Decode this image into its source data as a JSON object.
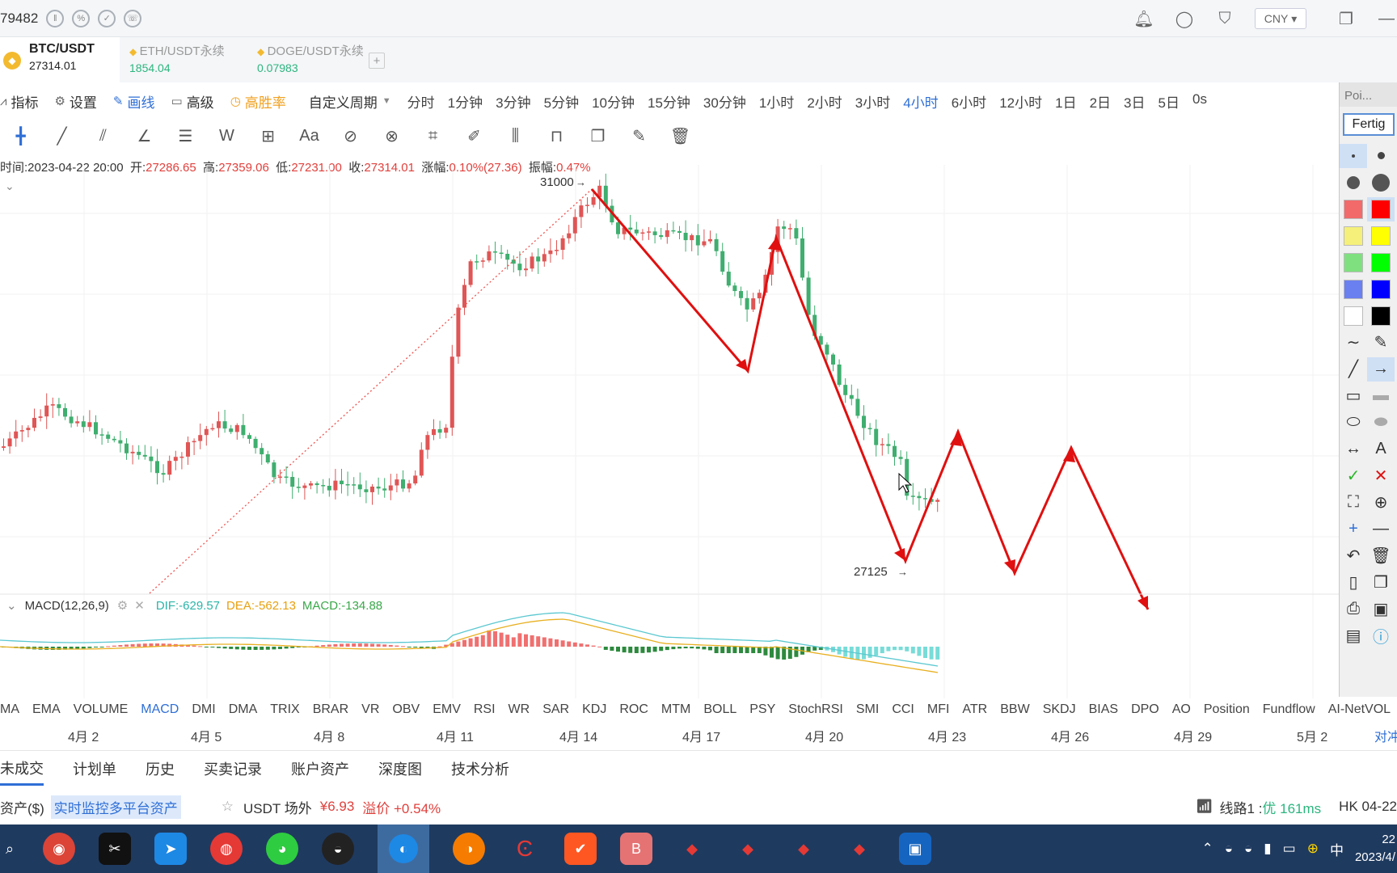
{
  "topbar": {
    "account_id": "79482",
    "currency": "CNY",
    "currency_arrow": "▾",
    "icons": [
      "bell-icon",
      "chat-icon",
      "shirt-icon",
      "window-icon",
      "minimize-icon"
    ]
  },
  "tabs": [
    {
      "pair": "BTC/USDT",
      "price": "27314.01",
      "active": true
    },
    {
      "pair": "ETH/USDT永续",
      "price": "1854.04",
      "active": false
    },
    {
      "pair": "DOGE/USDT永续",
      "price": "0.07983",
      "active": false
    }
  ],
  "add_tab": "+",
  "menu": {
    "indicator": "指标",
    "settings": "设置",
    "draw": "画线",
    "advanced": "高级",
    "win_rate": "高胜率",
    "custom_period": "自定义周期",
    "periods": [
      "分时",
      "1分钟",
      "3分钟",
      "5分钟",
      "10分钟",
      "15分钟",
      "30分钟",
      "1小时",
      "2小时",
      "3小时",
      "4小时",
      "6小时",
      "12小时",
      "1日",
      "2日",
      "3日",
      "5日",
      "0s"
    ],
    "selected_period": "4小时"
  },
  "ohlc": {
    "time_label": "时间:",
    "time": "2023-04-22 20:00",
    "open_label": "开:",
    "open": "27286.65",
    "high_label": "高:",
    "high": "27359.06",
    "low_label": "低:",
    "low": "27231.00",
    "close_label": "收:",
    "close": "27314.01",
    "change_label": "涨幅:",
    "change": "0.10%(27.36)",
    "amp_label": "振幅:",
    "amp": "0.47%"
  },
  "chart_annotations": {
    "high_mark": "31000",
    "low_mark": "27125",
    "arrow_glyph": "→",
    "collapse_glyph": "⌄"
  },
  "macd": {
    "label": "MACD(12,26,9)",
    "dif": "DIF:-629.57",
    "dea": "DEA:-562.13",
    "macd": "MACD:-134.88"
  },
  "indicators": [
    "MA",
    "EMA",
    "VOLUME",
    "MACD",
    "DMI",
    "DMA",
    "TRIX",
    "BRAR",
    "VR",
    "OBV",
    "EMV",
    "RSI",
    "WR",
    "SAR",
    "KDJ",
    "ROC",
    "MTM",
    "BOLL",
    "PSY",
    "StochRSI",
    "SMI",
    "CCI",
    "MFI",
    "ATR",
    "BBW",
    "SKDJ",
    "BIAS",
    "DPO",
    "AO",
    "Position",
    "Fundflow",
    "AI-NetVOL"
  ],
  "selected_indicator": "MACD",
  "date_axis": [
    "4月 2",
    "4月 5",
    "4月 8",
    "4月 11",
    "4月 14",
    "4月 17",
    "4月 20",
    "4月 23",
    "4月 26",
    "4月 29",
    "5月 2"
  ],
  "date_axis_tail": "对冲",
  "order_tabs": [
    "未成交",
    "计划单",
    "历史",
    "买卖记录",
    "账户资产",
    "深度图",
    "技术分析"
  ],
  "status": {
    "asset": "资产($)",
    "monitor": "实时监控多平台资产",
    "usdt": "USDT 场外",
    "usdt_price": "¥6.93",
    "premium": "溢价 +0.54%",
    "line": "线路1 : ",
    "line_quality": "优 161ms",
    "region": "HK 04-22"
  },
  "taskbar": {
    "time": "22",
    "date": "2023/4/",
    "ime": "中"
  },
  "palette": {
    "title": "Poi...",
    "done": "Fertig",
    "colors": [
      "#f26a6a",
      "#ff0000",
      "#f5f07a",
      "#ffff00",
      "#7fe07f",
      "#00ff00",
      "#6a7ff0",
      "#0000ff",
      "#ffffff",
      "#000000"
    ]
  },
  "chart_data": {
    "type": "candlestick",
    "timeframe": "4小时",
    "y_marks": {
      "high": 31000,
      "low": 27125
    },
    "x_ticks": [
      "4月 2",
      "4月 5",
      "4月 8",
      "4月 11",
      "4月 14",
      "4月 17",
      "4月 20",
      "4月 23",
      "4月 26",
      "4月 29",
      "5月 2"
    ],
    "last_candle": {
      "open": 27286.65,
      "high": 27359.06,
      "low": 27231.0,
      "close": 27314.01
    },
    "macd": {
      "dif": -629.57,
      "dea": -562.13,
      "hist": -134.88
    }
  }
}
